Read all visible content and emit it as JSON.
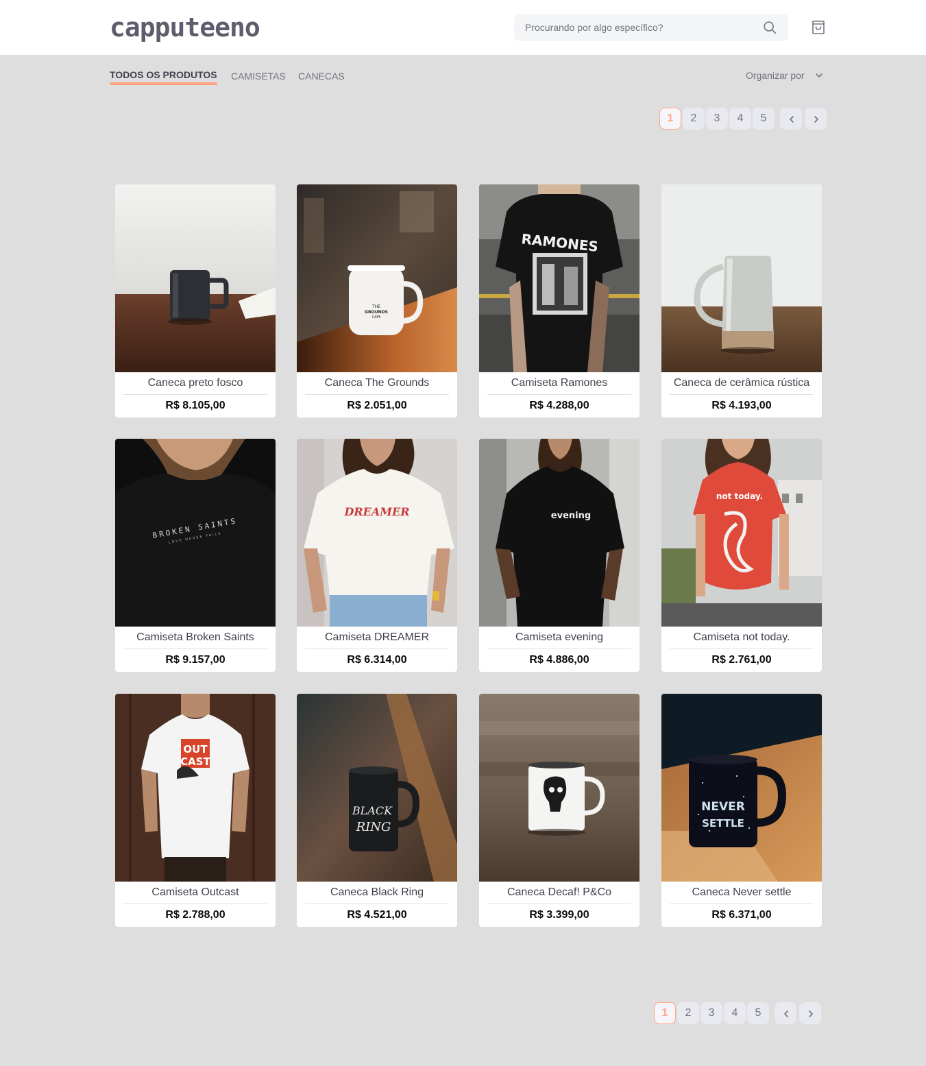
{
  "header": {
    "logo": "capputeeno",
    "search_placeholder": "Procurando por algo específico?",
    "search_icon": "search-icon",
    "cart_icon": "shopping-bag-icon"
  },
  "filters": {
    "tabs": [
      {
        "label": "TODOS OS PRODUTOS",
        "active": true
      },
      {
        "label": "CAMISETAS",
        "active": false
      },
      {
        "label": "CANECAS",
        "active": false
      }
    ],
    "sort_label": "Organizar por",
    "sort_icon": "chevron-down-icon"
  },
  "pagination": {
    "pages": [
      "1",
      "2",
      "3",
      "4",
      "5"
    ],
    "current": "1",
    "prev_icon": "chevron-left-icon",
    "next_icon": "chevron-right-icon"
  },
  "products": [
    {
      "name": "Caneca preto fosco",
      "price": "R$ 8.105,00"
    },
    {
      "name": "Caneca The Grounds",
      "price": "R$ 2.051,00"
    },
    {
      "name": "Camiseta Ramones",
      "price": "R$ 4.288,00"
    },
    {
      "name": "Caneca de cerâmica rústica",
      "price": "R$ 4.193,00"
    },
    {
      "name": "Camiseta Broken Saints",
      "price": "R$ 9.157,00"
    },
    {
      "name": "Camiseta DREAMER",
      "price": "R$ 6.314,00"
    },
    {
      "name": "Camiseta evening",
      "price": "R$ 4.886,00"
    },
    {
      "name": "Camiseta not today.",
      "price": "R$ 2.761,00"
    },
    {
      "name": "Camiseta Outcast",
      "price": "R$ 2.788,00"
    },
    {
      "name": "Caneca Black Ring",
      "price": "R$ 4.521,00"
    },
    {
      "name": "Caneca Decaf! P&Co",
      "price": "R$ 3.399,00"
    },
    {
      "name": "Caneca Never settle",
      "price": "R$ 6.371,00"
    }
  ],
  "product_art": {
    "ramones": "RAMONES",
    "broken_saints": "BROKEN SAINTS",
    "broken_saints_sub": "LOVE NEVER FAILS",
    "dreamer": "DREAMER",
    "evening": "evening",
    "not_today": "not today.",
    "outcast_1": "OUT",
    "outcast_2": "CAST",
    "black_ring_1": "BLACK",
    "black_ring_2": "RING",
    "never_settle_1": "NEVER",
    "never_settle_2": "SETTLE",
    "grounds_1": "THE",
    "grounds_2": "GROUNDS",
    "grounds_3": "CAFE"
  }
}
